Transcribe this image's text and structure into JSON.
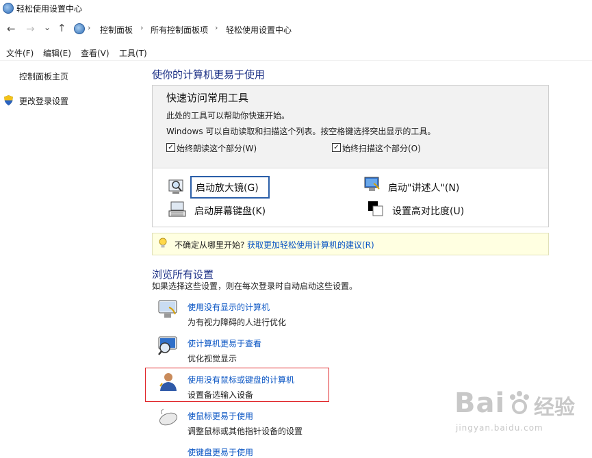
{
  "window": {
    "title": "轻松使用设置中心"
  },
  "address": {
    "crumbs": [
      "控制面板",
      "所有控制面板项",
      "轻松使用设置中心"
    ],
    "separator": "›"
  },
  "nav": {
    "back": "←",
    "forward": "→",
    "recent": "⌄",
    "up": "↑"
  },
  "menu": {
    "file": "文件(F)",
    "edit": "编辑(E)",
    "view": "查看(V)",
    "tools": "工具(T)"
  },
  "sidebar": {
    "home": "控制面板主页",
    "login_settings": "更改登录设置"
  },
  "main": {
    "heading": "使你的计算机更易于使用",
    "quick": {
      "title": "快速访问常用工具",
      "line1": "此处的工具可以帮助你快速开始。",
      "line2": "Windows 可以自动读取和扫描这个列表。按空格键选择突出显示的工具。",
      "check_read": {
        "label": "始终朗读这个部分(W)",
        "checked": true
      },
      "check_scan": {
        "label": "始终扫描这个部分(O)",
        "checked": true
      },
      "tools": {
        "magnifier": "启动放大镜(G)",
        "narrator": "启动\"讲述人\"(N)",
        "keyboard": "启动屏幕键盘(K)",
        "contrast": "设置高对比度(U)"
      }
    },
    "tip": {
      "prefix": "不确定从哪里开始?",
      "link": "获取更加轻松使用计算机的建议(R)"
    },
    "browse": {
      "heading": "浏览所有设置",
      "desc": "如果选择这些设置，则在每次登录时自动启动这些设置。",
      "items": [
        {
          "title": "使用没有显示的计算机",
          "desc": "为有视力障碍的人进行优化"
        },
        {
          "title": "使计算机更易于查看",
          "desc": "优化视觉显示"
        },
        {
          "title": "使用没有鼠标或键盘的计算机",
          "desc": "设置备选输入设备"
        },
        {
          "title": "使鼠标更易于使用",
          "desc": "调整鼠标或其他指针设备的设置"
        },
        {
          "title": "使键盘更易于使用",
          "desc": ""
        }
      ]
    }
  },
  "watermark": {
    "brand": "Bai",
    "brand2": "经验",
    "url": "jingyan.baidu.com"
  },
  "colors": {
    "link": "#0b56c4",
    "heading": "#1e3287",
    "highlight_border": "#e0272b",
    "tip_bg": "#ffffe1"
  }
}
